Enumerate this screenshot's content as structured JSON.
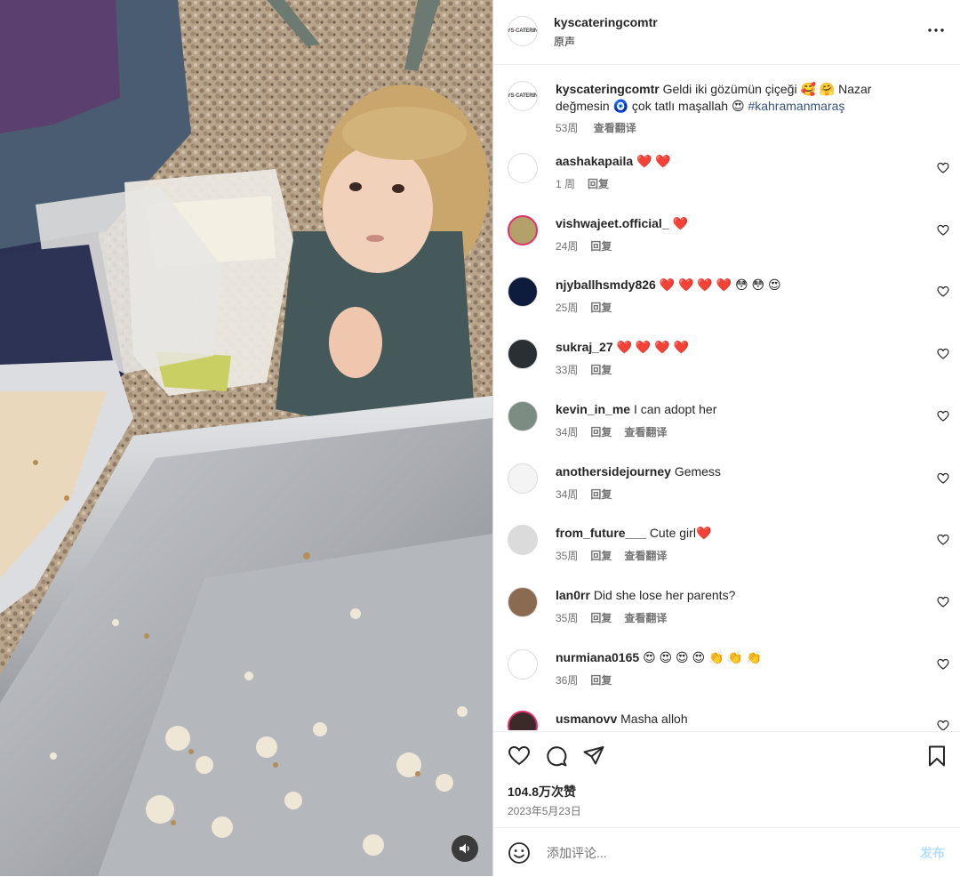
{
  "header": {
    "username": "kyscateringcomtr",
    "audio": "原声",
    "more_icon": "more-options-icon"
  },
  "caption": {
    "username": "kyscateringcomtr",
    "text": "Geldi iki gözümün çiçeği 🥰 🤗 Nazar değmesin 🧿 çok tatlı maşallah 😍",
    "hashtag": "#kahramanmaraş",
    "time": "53周",
    "translate": "查看翻译"
  },
  "comments": [
    {
      "username": "aashakapaila",
      "text": "❤️ ❤️",
      "time": "1 周",
      "reply": "回复",
      "translate": "",
      "avatar_color": "#ffffff"
    },
    {
      "username": "vishwajeet.official_",
      "text": "❤️",
      "time": "24周",
      "reply": "回复",
      "translate": "",
      "avatar_color": "#b3a16a"
    },
    {
      "username": "njyballhsmdy826",
      "text": "❤️ ❤️ ❤️ ❤️ 😳 😳 😍",
      "time": "25周",
      "reply": "回复",
      "translate": "",
      "avatar_color": "#0d1b3d"
    },
    {
      "username": "sukraj_27",
      "text": "❤️ ❤️ ❤️ ❤️",
      "time": "33周",
      "reply": "回复",
      "translate": "",
      "avatar_color": "#2a2f33"
    },
    {
      "username": "kevin_in_me",
      "text": "I can adopt her",
      "time": "34周",
      "reply": "回复",
      "translate": "查看翻译",
      "avatar_color": "#7c8c82"
    },
    {
      "username": "anothersidejourney",
      "text": "Gemess",
      "time": "34周",
      "reply": "回复",
      "translate": "",
      "avatar_color": "#f4f4f4"
    },
    {
      "username": "from_future___",
      "text": "Cute girl❤️",
      "time": "35周",
      "reply": "回复",
      "translate": "查看翻译",
      "avatar_color": "#dbdbdb"
    },
    {
      "username": "lan0rr",
      "text": "Did she lose her parents?",
      "time": "35周",
      "reply": "回复",
      "translate": "查看翻译",
      "avatar_color": "#8a6b52"
    },
    {
      "username": "nurmiana0165",
      "text": "😍 😍 😍 😍 👏 👏 👏",
      "time": "36周",
      "reply": "回复",
      "translate": "",
      "avatar_color": "#ffffff"
    },
    {
      "username": "usmanovv",
      "text": "Masha alloh",
      "time": "",
      "reply": "",
      "translate": "",
      "avatar_color": "#3a2a2a"
    }
  ],
  "actions": {
    "likes": "104.8万次赞",
    "date": "2023年5月23日"
  },
  "composer": {
    "placeholder": "添加评论...",
    "post": "发布"
  },
  "colors": {
    "link": "#385185",
    "heart": "#ed4956",
    "post_disabled": "#b2dffc"
  }
}
